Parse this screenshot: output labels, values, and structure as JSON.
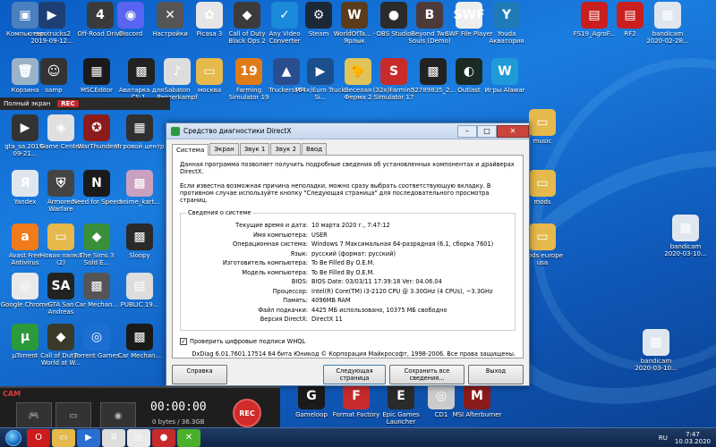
{
  "desktop": {
    "icons": [
      {
        "label": "Компьютер",
        "color": "#4a7fc0",
        "glyph": "▣"
      },
      {
        "label": "eurotrucks2 2019-09-12...",
        "color": "#1d3f73",
        "glyph": "▶"
      },
      {
        "label": "Off-Road Drive",
        "color": "#3a3a3a",
        "glyph": "4"
      },
      {
        "label": "Discord",
        "color": "#5865f2",
        "glyph": "◉"
      },
      {
        "label": "Настройки",
        "color": "#555",
        "glyph": "✕"
      },
      {
        "label": "Picasa 3",
        "color": "#e6e6e6",
        "glyph": "✿"
      },
      {
        "label": "Call of Duty Black Ops 2",
        "color": "#3b3b3b",
        "glyph": "◆"
      },
      {
        "label": "Any Video Converter",
        "color": "#1a8ad9",
        "glyph": "✓"
      },
      {
        "label": "Steam",
        "color": "#1b2838",
        "glyph": "⚙"
      },
      {
        "label": "WorldOfTa... - Ярлык",
        "color": "#5a3b1b",
        "glyph": "W"
      },
      {
        "label": "OBS Studio",
        "color": "#2b2b2b",
        "glyph": "●"
      },
      {
        "label": "Beyond Two Souls (Demo)",
        "color": "#4d3a3a",
        "glyph": "B"
      },
      {
        "label": "SWF File Player",
        "color": "#eeeeee",
        "glyph": "SWF"
      },
      {
        "label": "Youda Акватория",
        "color": "#1e7bb8",
        "glyph": "Y"
      },
      {
        "label": "FS19_AgroF...",
        "color": "#c91f1f",
        "glyph": "▤"
      },
      {
        "label": "RF2",
        "color": "#c91f1f",
        "glyph": "▤"
      },
      {
        "label": "bandicam 2020-02-28...",
        "color": "#dfe6ee",
        "glyph": "▦"
      },
      {
        "label": "Корзина",
        "color": "#9bb3c9",
        "glyph": "🗑"
      },
      {
        "label": "samp",
        "color": "#333",
        "glyph": "☺"
      },
      {
        "label": "MSCEditor",
        "color": "#1a1a1a",
        "glyph": "▦"
      },
      {
        "label": "Аватарка для CS:1...",
        "color": "#222",
        "glyph": "▩"
      },
      {
        "label": "Sabaton Panzerkampf",
        "color": "#dddddd",
        "glyph": "♪"
      },
      {
        "label": "москва",
        "color": "#e5b94c",
        "glyph": "▭"
      },
      {
        "label": "Farming Simulator 19",
        "color": "#e07b1a",
        "glyph": "19"
      },
      {
        "label": "TruckersMP",
        "color": "#2a4d8f",
        "glyph": "▲"
      },
      {
        "label": "(64x)Euro Truck Si...",
        "color": "#1b4e8c",
        "glyph": "▶"
      },
      {
        "label": "Веселая Ферма 2",
        "color": "#e0c35a",
        "glyph": "🐤"
      },
      {
        "label": "(32x)Farming Simulator 17",
        "color": "#c92b2b",
        "glyph": "S"
      },
      {
        "label": "52789835_2...",
        "color": "#222",
        "glyph": "▩"
      },
      {
        "label": "Outlast",
        "color": "#1b2a22",
        "glyph": "◐"
      },
      {
        "label": "Игры Alawar",
        "color": "#1f9bd9",
        "glyph": "W"
      },
      {
        "label": "gta_sa 2019-09-21...",
        "color": "#333",
        "glyph": "▶"
      },
      {
        "label": "Game Center",
        "color": "#e0e0e0",
        "glyph": "◈"
      },
      {
        "label": "WarThunder",
        "color": "#8c1b1b",
        "glyph": "✪"
      },
      {
        "label": "Игровой центр",
        "color": "#303030",
        "glyph": "▦"
      },
      {
        "label": "Yandex",
        "color": "#dfe6ee",
        "glyph": "Я"
      },
      {
        "label": "Armored Warfare",
        "color": "#444",
        "glyph": "⛨"
      },
      {
        "label": "Need for Speed",
        "color": "#1a1a1a",
        "glyph": "N"
      },
      {
        "label": "anime_kart...",
        "color": "#c9a0c0",
        "glyph": "▩"
      },
      {
        "label": "Avast Free Antivirus",
        "color": "#f07b1a",
        "glyph": "a"
      },
      {
        "label": "Новая папка (2)",
        "color": "#e5b94c",
        "glyph": "▭"
      },
      {
        "label": "The Sims 3 Sold E...",
        "color": "#3a8f3a",
        "glyph": "◆"
      },
      {
        "label": "Sloopy",
        "color": "#2a2a2a",
        "glyph": "▩"
      },
      {
        "label": "Google Chrome",
        "color": "#e9e9e9",
        "glyph": "◎"
      },
      {
        "label": "GTA San Andreas",
        "color": "#222",
        "glyph": "SA"
      },
      {
        "label": "Car Mechan...",
        "color": "#555",
        "glyph": "▩"
      },
      {
        "label": "PUBLIC 19...",
        "color": "#dddddd",
        "glyph": "▤"
      },
      {
        "label": "µTorrent",
        "color": "#2c9a3a",
        "glyph": "µ"
      },
      {
        "label": "Call of Duty - World at W...",
        "color": "#3a3a2a",
        "glyph": "◆"
      },
      {
        "label": "Torrent Games",
        "color": "#1d6ed1",
        "glyph": "◎"
      },
      {
        "label": "Car Mechan...",
        "color": "#1a1a1a",
        "glyph": "▩"
      },
      {
        "label": "music",
        "color": "#e5b94c",
        "glyph": "▭"
      },
      {
        "label": "mods",
        "color": "#e5b94c",
        "glyph": "▭"
      },
      {
        "label": "mods europe usa",
        "color": "#e5b94c",
        "glyph": "▭"
      },
      {
        "label": "bandicam 2020-03-10...",
        "color": "#dfe6ee",
        "glyph": "▦"
      },
      {
        "label": "bandicam 2020-03-10...",
        "color": "#dfe6ee",
        "glyph": "▦"
      },
      {
        "label": "Gameloop",
        "color": "#1a1a1a",
        "glyph": "G"
      },
      {
        "label": "Format Factory",
        "color": "#c72b2b",
        "glyph": "F"
      },
      {
        "label": "Epic Games Launcher",
        "color": "#2a2a2a",
        "glyph": "E"
      },
      {
        "label": "CD1",
        "color": "#cccccc",
        "glyph": "◎"
      },
      {
        "label": "MSI Afterburner",
        "color": "#8c1b1b",
        "glyph": "M"
      }
    ]
  },
  "bandicam_bar": {
    "mode_label": "Полный экран",
    "rec_label": "REC"
  },
  "dxdiag": {
    "title": "Средство диагностики DirectX",
    "tabs": [
      "Система",
      "Экран",
      "Звук 1",
      "Звук 2",
      "Ввод"
    ],
    "intro": "Данная программа позволяет получить подробные сведения об установленных компонентах и драйверах DirectX.",
    "hint": "Если известна возможная причина неполадки, можно сразу выбрать соответствующую вкладку. В противном случае используйте кнопку \"Следующая страница\" для последовательного просмотра страниц.",
    "group_title": "Сведения о системе",
    "info": [
      {
        "k": "Текущие время и дата:",
        "v": "10 марта 2020 г., 7:47:12"
      },
      {
        "k": "Имя компьютера:",
        "v": "USER"
      },
      {
        "k": "Операционная система:",
        "v": "Windows 7 Максимальная 64-разрядная (6.1, сборка 7601)"
      },
      {
        "k": "Язык:",
        "v": "русский (формат: русский)"
      },
      {
        "k": "Изготовитель компьютера:",
        "v": "To Be Filled By O.E.M."
      },
      {
        "k": "Модель компьютера:",
        "v": "To Be Filled By O.E.M."
      },
      {
        "k": "BIOS:",
        "v": "BIOS Date: 03/03/11 17:39:18 Ver: 04.06.04"
      },
      {
        "k": "Процессор:",
        "v": "Intel(R) Core(TM) i3-2120 CPU @ 3.30GHz (4 CPUs), ~3.3GHz"
      },
      {
        "k": "Память:",
        "v": "4096MB RAM"
      },
      {
        "k": "Файл подкачки:",
        "v": "4425 МБ использовано, 10375 МБ свободно"
      },
      {
        "k": "Версия DirectX:",
        "v": "DirectX 11"
      }
    ],
    "whql_label": "Проверить цифровые подписи WHQL",
    "copyright": "DxDiag 6.01.7601.17514 64 бита Юникод  © Корпорация Майкрософт, 1998-2006. Все права защищены.",
    "buttons": {
      "help": "Справка",
      "next": "Следующая страница",
      "save": "Сохранить все сведения...",
      "exit": "Выход"
    }
  },
  "bandicam": {
    "logo": "CAM",
    "timer": "00:00:00",
    "size": "0 bytes / 36.3GB",
    "rec": "REC"
  },
  "taskbar": {
    "items": [
      {
        "name": "opera",
        "glyph": "O",
        "color": "#cc1b1b"
      },
      {
        "name": "explorer",
        "glyph": "▭",
        "color": "#e5b94c"
      },
      {
        "name": "media-player",
        "glyph": "▶",
        "color": "#2a6fd0"
      },
      {
        "name": "yandex",
        "glyph": "Я",
        "color": "#dddddd"
      },
      {
        "name": "chrome",
        "glyph": "◎",
        "color": "#e9e9e9"
      },
      {
        "name": "bandicam",
        "glyph": "●",
        "color": "#c62b2b"
      },
      {
        "name": "dxdiag",
        "glyph": "✕",
        "color": "#4caf2a"
      }
    ],
    "lang": "RU",
    "time": "7:47",
    "date": "10.03.2020"
  }
}
